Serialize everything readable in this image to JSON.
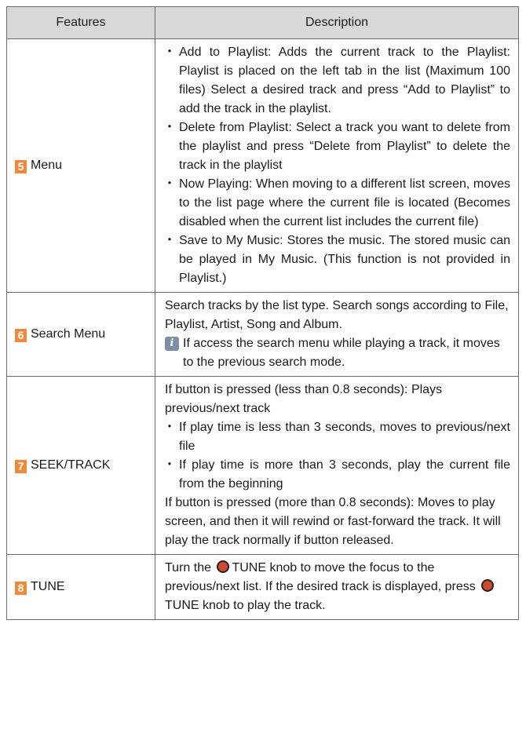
{
  "header": {
    "features": "Features",
    "description": "Description"
  },
  "rows": [
    {
      "number": "5",
      "feature": "Menu",
      "bullets": [
        "Add to Playlist: Adds the current track to the Playlist: Playlist is placed on the left tab in the list (Maximum 100 files) Select a desired track and press “Add to Playlist” to add the track in the playlist.",
        "Delete from Playlist: Select a track you want to delete from the playlist and press “Delete from Playlist” to delete the track in the playlist",
        "Now Playing: When moving to a different list screen, moves to the list page where the current file is located (Becomes disabled when the current list includes the current file)",
        "Save to My Music: Stores the music. The stored music can be played in My Music. (This function is not provided in Playlist.)"
      ]
    },
    {
      "number": "6",
      "feature": "Search Menu",
      "text": "Search tracks by the list type. Search songs according to File, Playlist, Artist, Song and Album.",
      "note_icon": "i",
      "note": "If access the search menu while playing a track, it moves to the previous search mode."
    },
    {
      "number": "7",
      "feature": "SEEK/TRACK",
      "text1": "If button is pressed (less than 0.8 seconds): Plays previous/next track",
      "bullets": [
        "If play time is less than 3 seconds, moves to previous/next file",
        "If play time is more than 3 seconds, play the current file from the beginning"
      ],
      "text2": "If button is pressed (more than 0.8 seconds): Moves to play screen, and then it will rewind or fast-forward the track. It will play the track normally if button released."
    },
    {
      "number": "8",
      "feature": "TUNE",
      "part1": "Turn the",
      "knob_label_1": "TUNE",
      "part2": "knob to move the focus to the previous/next list. If the desired track is displayed, press",
      "knob_label_2": "TUNE",
      "part3": "knob to play the track."
    }
  ],
  "colors": {
    "number_badge": "#f1893a",
    "header_bg": "#d9d9d9",
    "note_icon": "#7b8fa8",
    "knob": "#d24a2e"
  }
}
